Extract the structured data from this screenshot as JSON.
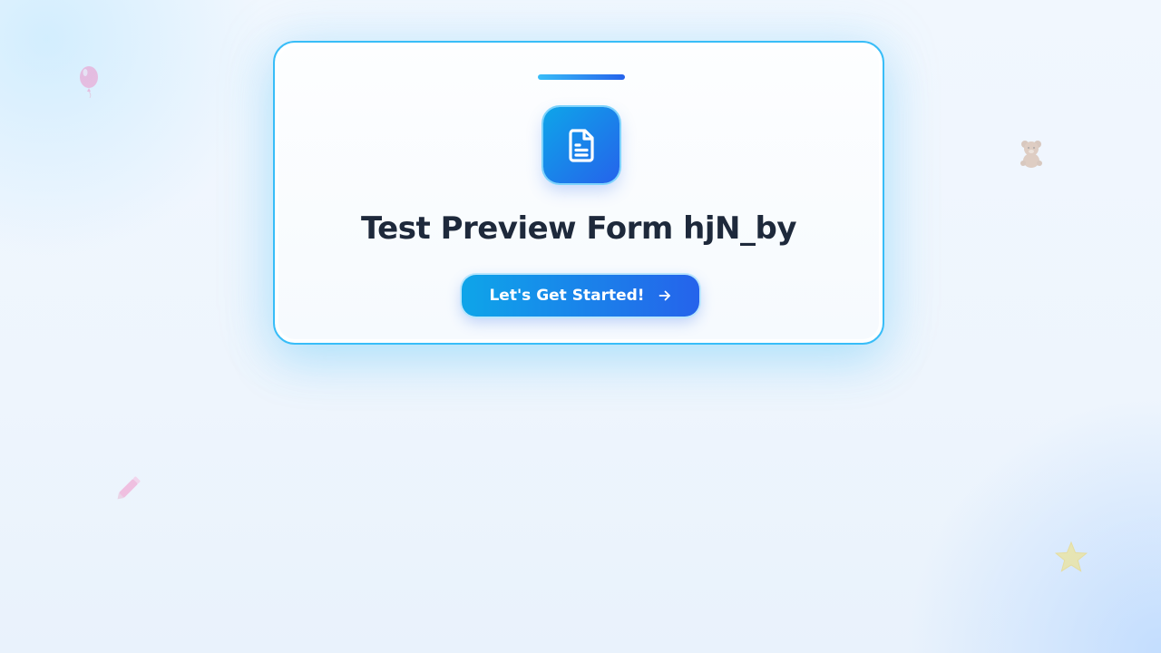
{
  "form": {
    "title": "Test Preview Form hjN_by",
    "start_button_label": "Let's Get Started!",
    "icon": "document-icon",
    "start_button_icon": "arrow-right-icon"
  },
  "decorations": [
    "balloon-icon",
    "teddy-bear-icon",
    "pencil-icon",
    "star-icon"
  ],
  "colors": {
    "accent_start": "#0ea5e9",
    "accent_end": "#2563eb",
    "card_border": "#38bdf8",
    "title": "#1e293b"
  }
}
